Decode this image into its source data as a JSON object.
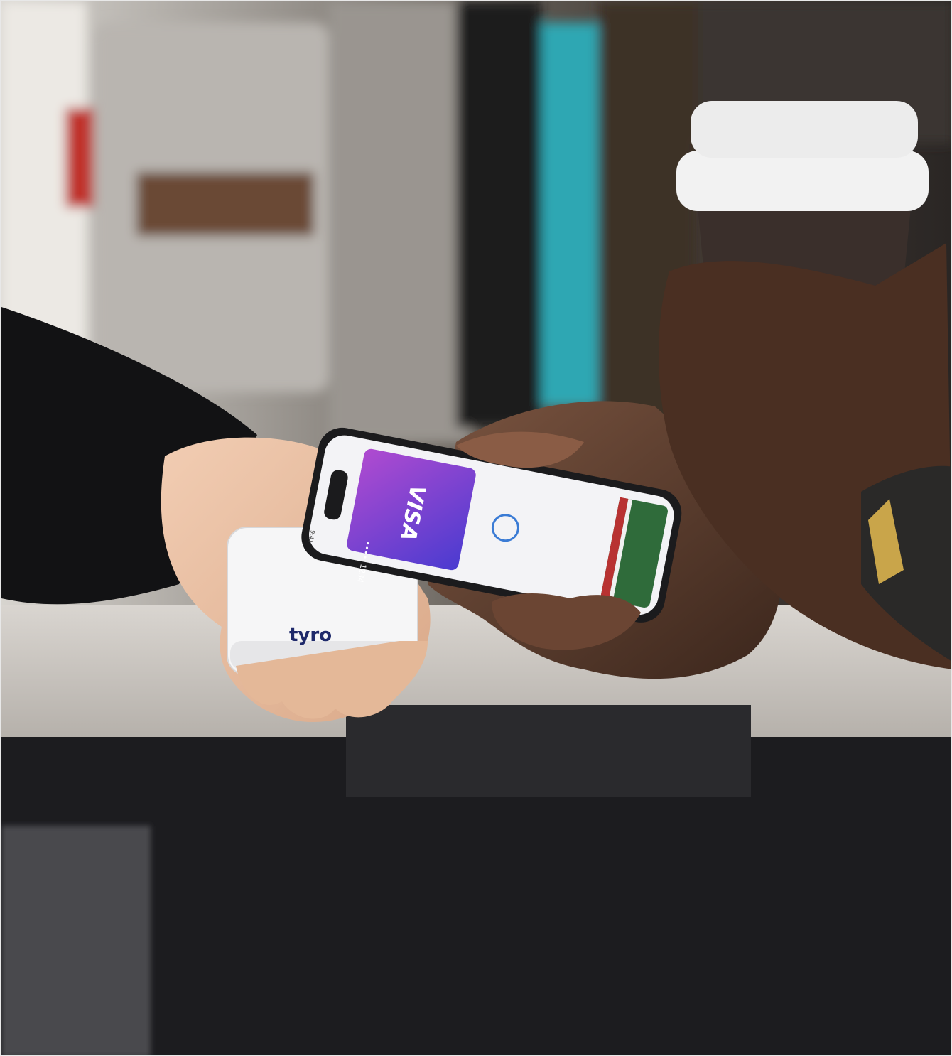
{
  "photo": {
    "description_icon": "photo-icon",
    "reader_logo": "tyro",
    "card_brand": "VISA",
    "card_number_mask": "•••• 1234",
    "phone_time": "9:41",
    "colors": {
      "reader_logo": "#1f2a6b",
      "card_gradient_top": "#b04bd0",
      "card_gradient_bottom": "#4a3bd0",
      "cup_lid": "#f2f2f2",
      "cup_body": "#3a2f2b",
      "counter": "#c9c4c0",
      "counter_front": "#1c1c1f"
    }
  }
}
